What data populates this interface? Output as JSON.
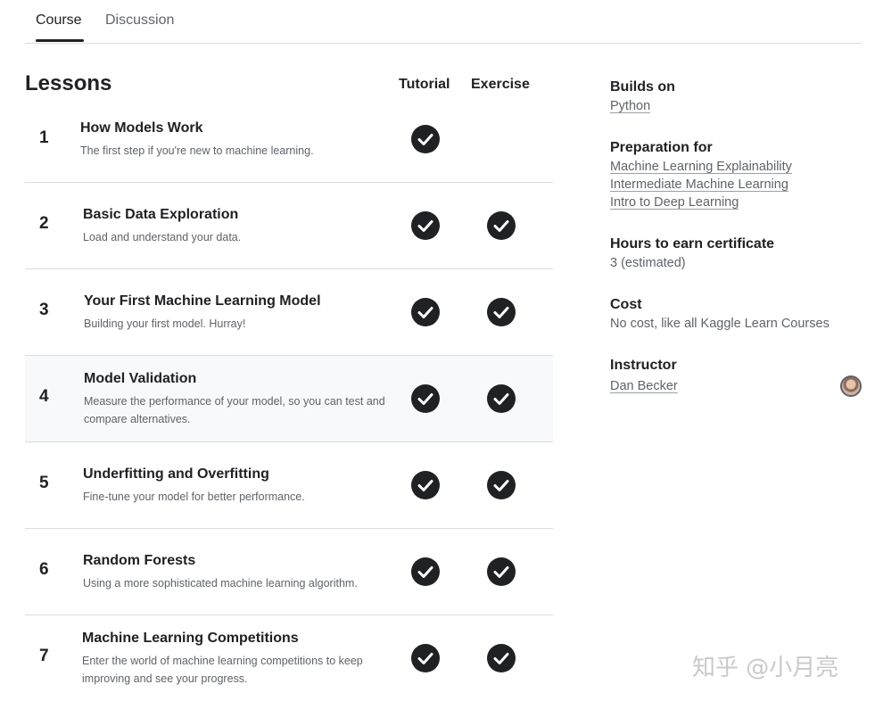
{
  "tabs": [
    {
      "label": "Course",
      "active": true
    },
    {
      "label": "Discussion",
      "active": false
    }
  ],
  "lessons_header": {
    "title": "Lessons",
    "tutorial_label": "Tutorial",
    "exercise_label": "Exercise"
  },
  "lessons": [
    {
      "number": "1",
      "title": "How Models Work",
      "description": "The first step if you're new to machine learning.",
      "tutorial_done": true,
      "exercise_done": false
    },
    {
      "number": "2",
      "title": "Basic Data Exploration",
      "description": "Load and understand your data.",
      "tutorial_done": true,
      "exercise_done": true
    },
    {
      "number": "3",
      "title": "Your First Machine Learning Model",
      "description": "Building your first model. Hurray!",
      "tutorial_done": true,
      "exercise_done": true
    },
    {
      "number": "4",
      "title": "Model Validation",
      "description": "Measure the performance of your model, so you can test and compare alternatives.",
      "tutorial_done": true,
      "exercise_done": true
    },
    {
      "number": "5",
      "title": "Underfitting and Overfitting",
      "description": "Fine-tune your model for better performance.",
      "tutorial_done": true,
      "exercise_done": true
    },
    {
      "number": "6",
      "title": "Random Forests",
      "description": "Using a more sophisticated machine learning algorithm.",
      "tutorial_done": true,
      "exercise_done": true
    },
    {
      "number": "7",
      "title": "Machine Learning Competitions",
      "description": "Enter the world of machine learning competitions to keep improving and see your progress.",
      "tutorial_done": true,
      "exercise_done": true
    }
  ],
  "sidebar": {
    "builds_on_label": "Builds on",
    "builds_on": [
      "Python"
    ],
    "preparation_label": "Preparation for",
    "preparation": [
      "Machine Learning Explainability",
      "Intermediate Machine Learning",
      "Intro to Deep Learning"
    ],
    "hours_label": "Hours to earn certificate",
    "hours_value": "3 (estimated)",
    "cost_label": "Cost",
    "cost_value": "No cost, like all Kaggle Learn Courses",
    "instructor_label": "Instructor",
    "instructor_name": "Dan Becker"
  },
  "watermark": "知乎 @小月亮",
  "colors": {
    "text_primary": "#202124",
    "text_secondary": "#5f6368",
    "divider": "#dadce0",
    "row_highlight": "#f8f9fa",
    "check_fill": "#202124"
  }
}
